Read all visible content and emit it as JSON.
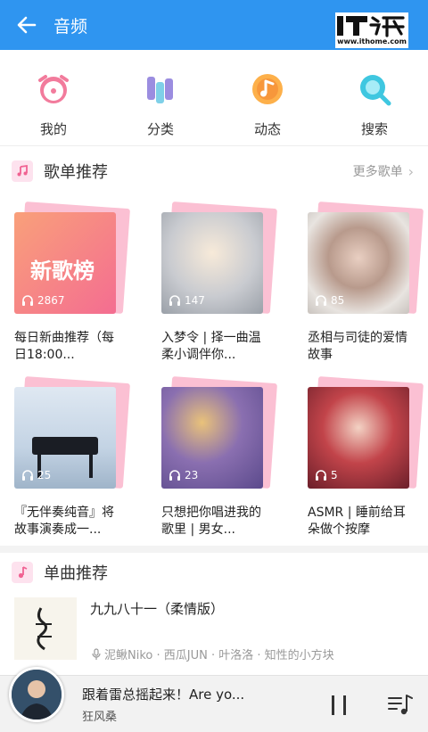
{
  "appbar": {
    "title": "音频",
    "logo_text": "IT之家",
    "logo_url": "www.ithome.com"
  },
  "topnav": [
    {
      "label": "我的",
      "icon": "alarm-clock-icon"
    },
    {
      "label": "分类",
      "icon": "category-bars-icon"
    },
    {
      "label": "动态",
      "icon": "music-note-circle-icon"
    },
    {
      "label": "搜索",
      "icon": "search-icon"
    }
  ],
  "playlists_section": {
    "title": "歌单推荐",
    "more": "更多歌单"
  },
  "playlists": [
    {
      "title": "每日新曲推荐（每日18:00...",
      "count": "2867",
      "cover_text": "新歌榜"
    },
    {
      "title": "入梦令 | 择一曲温柔小调伴你...",
      "count": "147"
    },
    {
      "title": "丞相与司徒的爱情故事",
      "count": "85"
    },
    {
      "title": "『无伴奏纯音』将故事演奏成一...",
      "count": "25"
    },
    {
      "title": "只想把你唱进我的歌里 | 男女...",
      "count": "23"
    },
    {
      "title": "ASMR | 睡前给耳朵做个按摩",
      "count": "5"
    }
  ],
  "songs_section": {
    "title": "单曲推荐"
  },
  "song": {
    "title": "九九八十一（柔情版）",
    "artists": "泥鳅Niko · 西瓜JUN · 叶洛洛 · 知性的小方块"
  },
  "player": {
    "title": "跟着雷总摇起来！Are yo...",
    "artist": "狂风桑"
  },
  "colors": {
    "appbar": "#2f95f0",
    "accent_pink": "#f06292"
  }
}
